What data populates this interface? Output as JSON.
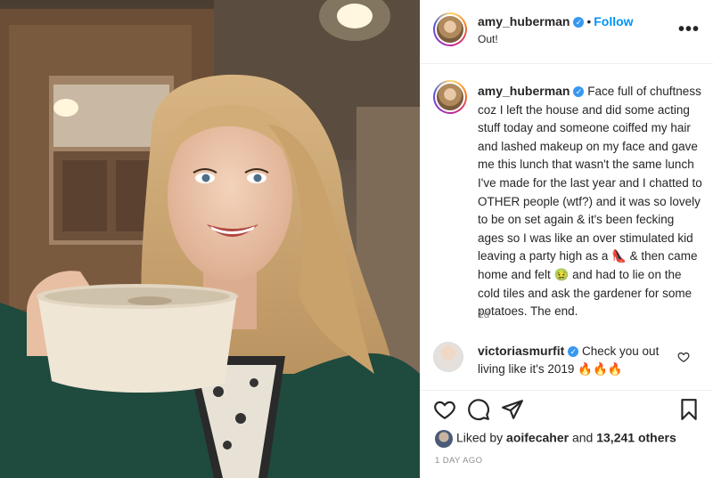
{
  "post": {
    "username": "amy_huberman",
    "follow_label": "Follow",
    "location": "Out!",
    "more_label": "•••",
    "caption": "Face full of chuftness coz I left the house and did some acting stuff today and someone coiffed my hair and lashed makeup on my face and gave me this lunch that wasn't the same lunch I've made for the last year and I chatted to OTHER people (wtf?) and it was so lovely to be on set again & it's been fecking ages so I was like an over stimulated kid leaving a party high as a 👠 & then came home and felt 🤢 and had to lie on the cold tiles and ask the gardener for some potatoes. The end.",
    "caption_age": "1d"
  },
  "comment": {
    "username": "victoriasmurfit",
    "text": "Check you out living like it's 2019 🔥🔥🔥"
  },
  "footer": {
    "liked_prefix": "Liked by ",
    "liked_user": "aoifecaher",
    "liked_and": " and ",
    "liked_count": "13,241 others",
    "date": "1 DAY AGO"
  },
  "icons": {
    "verified": "verified-check-icon",
    "like": "heart-icon",
    "comment": "comment-bubble-icon",
    "share": "paper-plane-icon",
    "save": "bookmark-icon"
  },
  "colors": {
    "link": "#0095f6",
    "verified": "#3897f0",
    "muted": "#8e8e8e"
  }
}
